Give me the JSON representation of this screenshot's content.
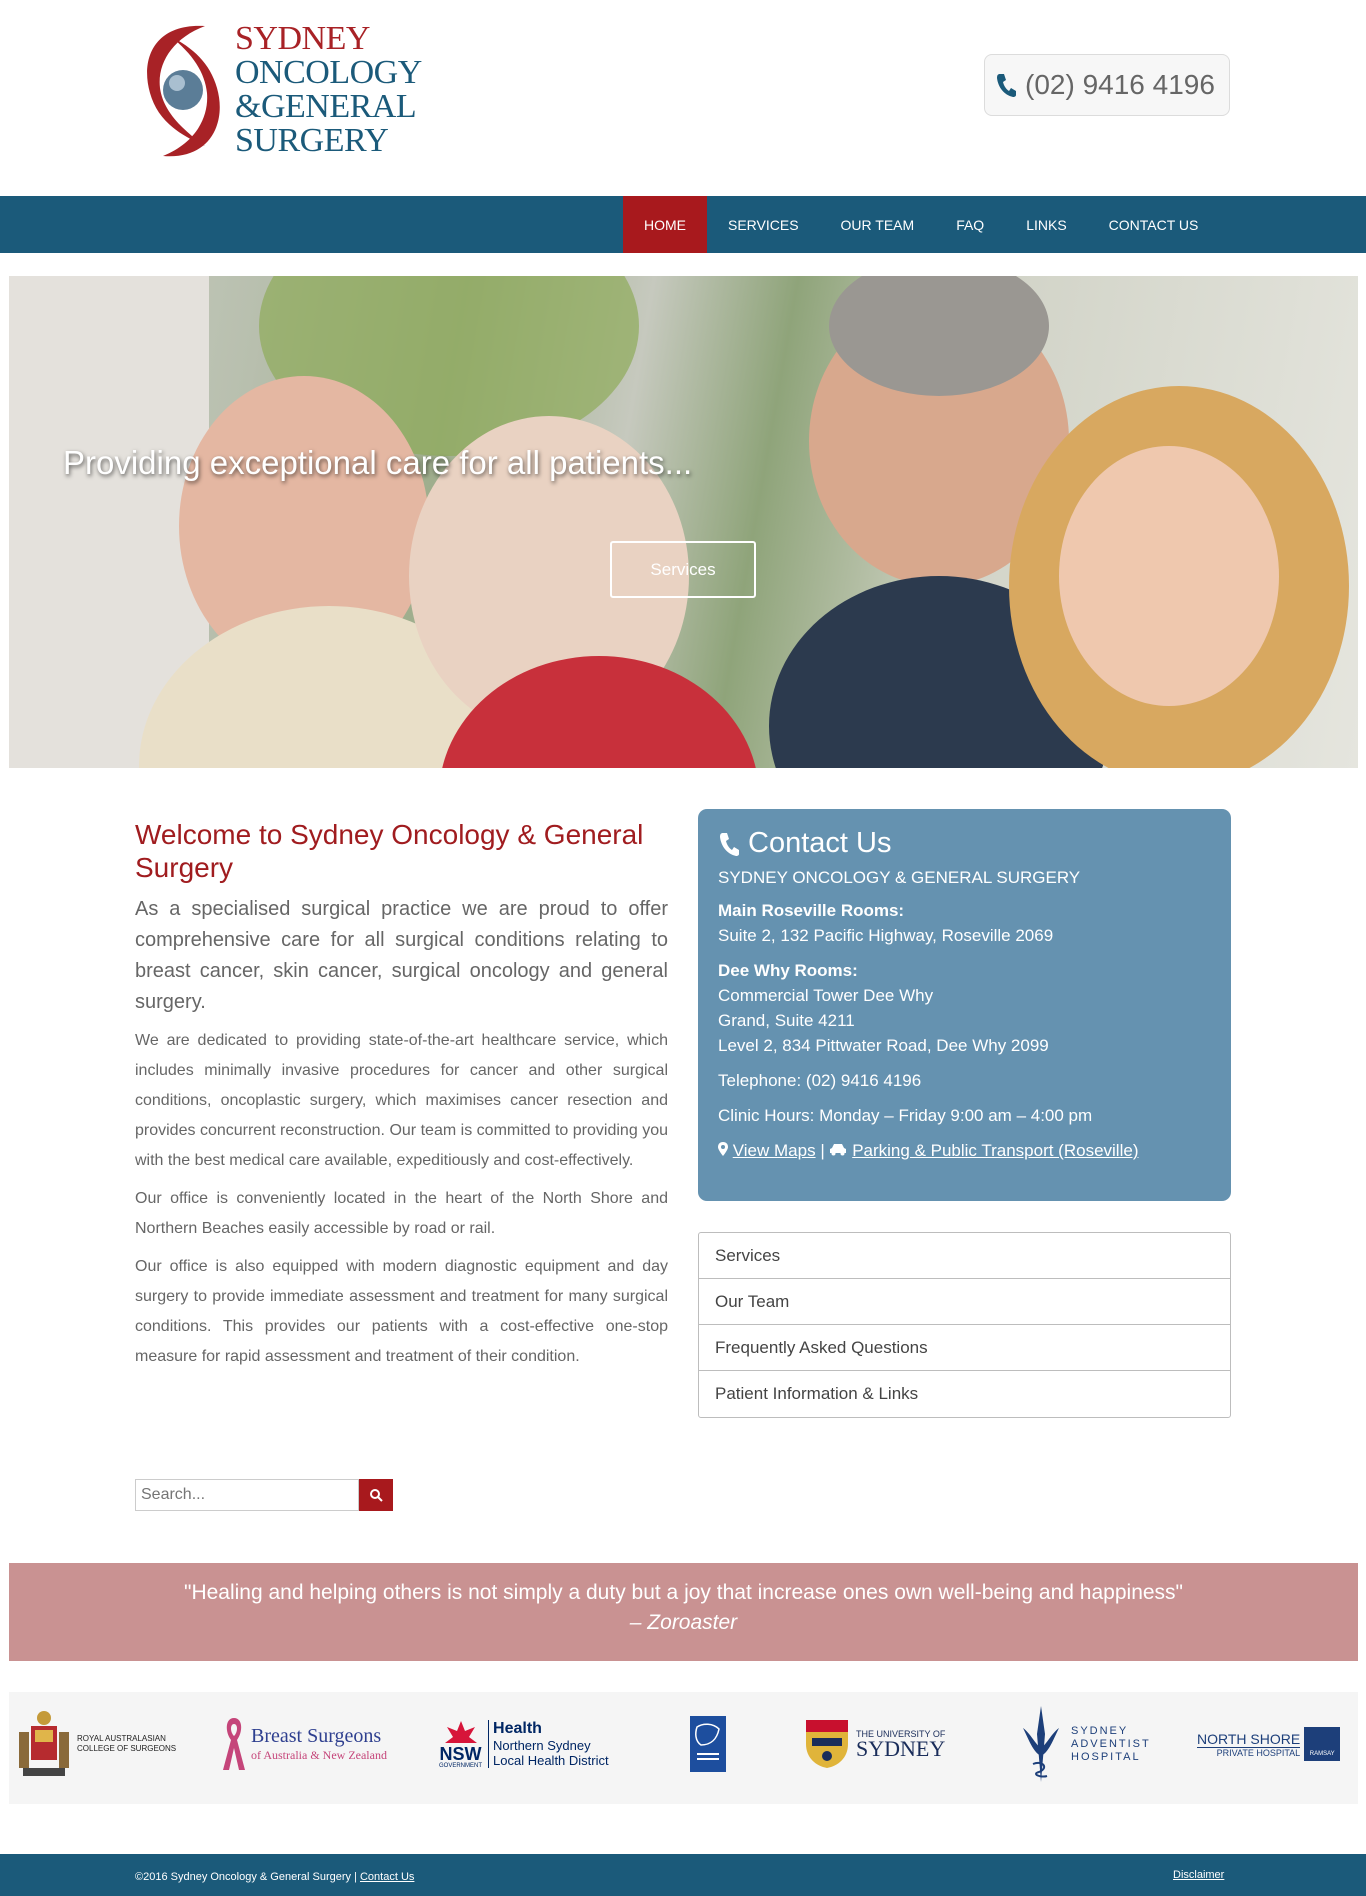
{
  "header": {
    "logo": {
      "line1": "SYDNEY",
      "line2": "ONCOLOGY",
      "line3": "&GENERAL",
      "line4": "SURGERY"
    },
    "phone": "(02) 9416 4196"
  },
  "nav": {
    "items": [
      {
        "label": "HOME",
        "active": true
      },
      {
        "label": "SERVICES"
      },
      {
        "label": "OUR TEAM"
      },
      {
        "label": "FAQ"
      },
      {
        "label": "LINKS"
      },
      {
        "label": "CONTACT US"
      }
    ]
  },
  "hero": {
    "caption": "Providing exceptional care for all patients...",
    "button": "Services"
  },
  "welcome": {
    "title": "Welcome to Sydney Oncology & General Surgery",
    "lead": "As a specialised surgical practice we are proud to offer comprehensive care for all surgical conditions relating to breast cancer, skin cancer, surgical oncology and general surgery.",
    "paragraphs": [
      "We are dedicated to providing state-of-the-art healthcare service, which includes minimally invasive procedures for cancer and other surgical conditions, oncoplastic surgery, which maximises cancer resection and provides concurrent reconstruction. Our team is committed to providing you with the best medical care available, expeditiously and cost-effectively.",
      "Our office is conveniently located in the heart of the North Shore and Northern Beaches easily accessible by road or rail.",
      "Our office is also equipped with modern diagnostic equipment and day surgery to provide immediate assessment and treatment for many surgical conditions. This provides our patients with a cost-effective one-stop measure for rapid assessment and treatment of their condition."
    ]
  },
  "search": {
    "placeholder": "Search..."
  },
  "contact": {
    "title": "Contact Us",
    "company": "SYDNEY ONCOLOGY & GENERAL SURGERY",
    "main_heading": "Main Roseville Rooms:",
    "main_address": "Suite 2, 132 Pacific Highway, Roseville 2069",
    "deewhy_heading": "Dee Why Rooms:",
    "deewhy_line1": "Commercial Tower Dee Why",
    "deewhy_line2": "Grand, Suite 4211",
    "deewhy_line3": "Level 2, 834 Pittwater Road, Dee Why 2099",
    "telephone": "Telephone: (02) 9416 4196",
    "hours": "Clinic Hours: Monday – Friday 9:00 am – 4:00 pm",
    "maps_link": "View Maps",
    "separator": "|",
    "parking_link": "Parking & Public Transport (Roseville)"
  },
  "sidemenu": {
    "items": [
      "Services",
      "Our Team",
      "Frequently Asked Questions",
      "Patient Information & Links"
    ]
  },
  "quote": {
    "text": "\"Healing and helping others is not simply a duty but a joy that increase ones own well-being and happiness\"",
    "author": "– Zoroaster"
  },
  "partners": {
    "racs_line1": "ROYAL AUSTRALASIAN",
    "racs_line2": "COLLEGE OF SURGEONS",
    "bs_line1": "Breast Surgeons",
    "bs_line2": "of Australia & New Zealand",
    "nsw_label": "NSW",
    "nsw_sub": "GOVERNMENT",
    "health_line1": "Health",
    "health_line2": "Northern Sydney",
    "health_line3": "Local Health District",
    "usyd_line1": "THE UNIVERSITY OF",
    "usyd_line2": "SYDNEY",
    "sah_line1": "SYDNEY",
    "sah_line2": "ADVENTIST",
    "sah_line3": "HOSPITAL",
    "nsph_line1": "NORTH SHORE",
    "nsph_line2": "PRIVATE HOSPITAL",
    "nsph_line3": "RAMSAY"
  },
  "footer": {
    "copyright": "©2016 Sydney Oncology & General Surgery |",
    "contact_link": "Contact Us",
    "disclaimer": "Disclaimer"
  },
  "colors": {
    "nav": "#1b5a7a",
    "accent": "#a8191d",
    "panel": "#6592b0",
    "quote": "#c99292"
  }
}
